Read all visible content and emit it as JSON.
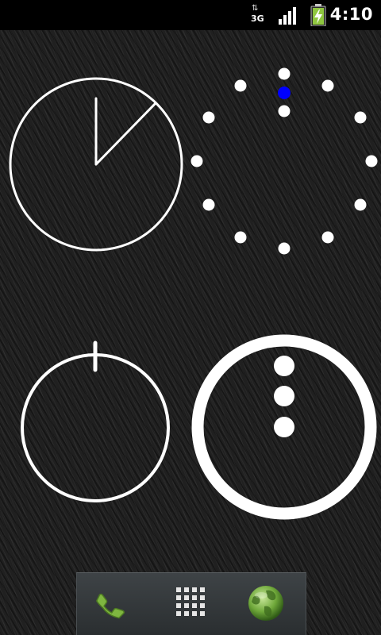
{
  "status_bar": {
    "network_label": "3G",
    "clock": "4:10",
    "icons": [
      "data-activity-icon",
      "signal-strength-icon",
      "battery-charging-icon"
    ]
  },
  "widgets": {
    "analog_clock": {
      "icon": "analog-clock-icon"
    },
    "dot_dial": {
      "icon": "dot-dial-icon",
      "accent_color": "#0000ff"
    },
    "power_button": {
      "icon": "power-icon"
    },
    "menu_button": {
      "icon": "vertical-ellipsis-icon"
    }
  },
  "dock": {
    "items": [
      {
        "icon": "phone-icon"
      },
      {
        "icon": "app-drawer-grid-icon"
      },
      {
        "icon": "browser-globe-icon"
      }
    ]
  },
  "colors": {
    "widget_white": "#ffffff",
    "accent_blue": "#0000ff",
    "phone_green": "#7fb640",
    "globe_green": "#6fa83a",
    "dock_bg": "#33383b"
  }
}
